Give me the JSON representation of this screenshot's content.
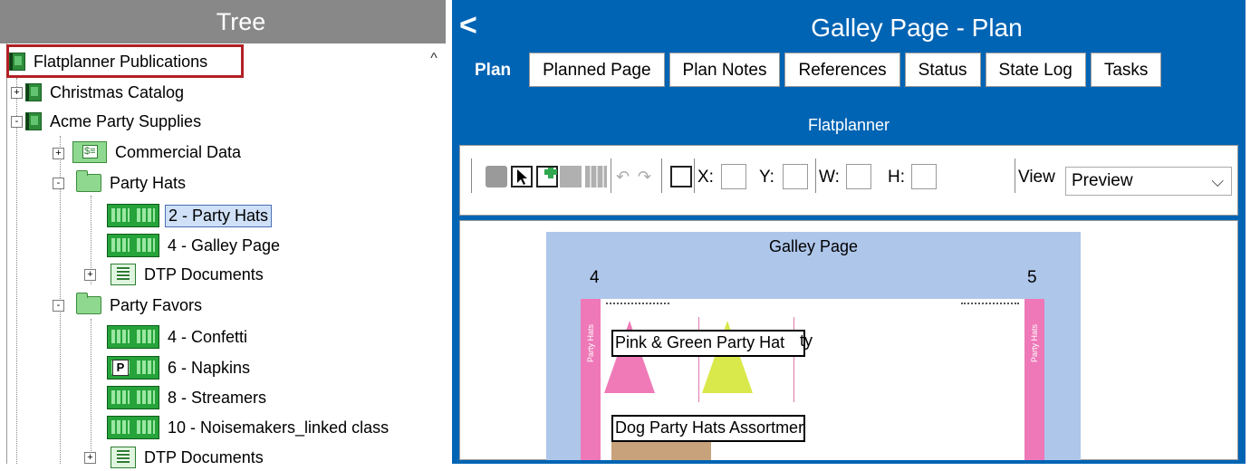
{
  "tree": {
    "title": "Tree",
    "scroll_up_glyph": "^",
    "items": [
      {
        "label": "Flatplanner Publications",
        "icon": "publications-icon",
        "expander": ""
      },
      {
        "label": "Christmas Catalog",
        "icon": "publication-icon",
        "expander": "+"
      },
      {
        "label": "Acme Party Supplies",
        "icon": "publication-icon",
        "expander": "-"
      },
      {
        "label": "Commercial Data",
        "icon": "commercial-data-icon",
        "expander": "+"
      },
      {
        "label": "Party Hats",
        "icon": "folder-icon",
        "expander": "-"
      },
      {
        "label": "2 - Party Hats",
        "icon": "page-spread-icon",
        "expander": "",
        "selected": true
      },
      {
        "label": "4 - Galley Page",
        "icon": "page-spread-icon",
        "expander": ""
      },
      {
        "label": "DTP Documents",
        "icon": "dtp-documents-icon",
        "expander": "+"
      },
      {
        "label": "Party Favors",
        "icon": "folder-icon",
        "expander": "-"
      },
      {
        "label": "4 - Confetti",
        "icon": "page-spread-icon",
        "expander": ""
      },
      {
        "label": "6 - Napkins",
        "icon": "page-spread-p-icon",
        "expander": ""
      },
      {
        "label": "8 - Streamers",
        "icon": "page-spread-icon",
        "expander": ""
      },
      {
        "label": "10 - Noisemakers_linked class",
        "icon": "page-spread-icon",
        "expander": ""
      },
      {
        "label": "DTP Documents",
        "icon": "dtp-documents-icon",
        "expander": "+"
      }
    ]
  },
  "right": {
    "title": "Galley Page - Plan",
    "back_glyph": "<",
    "tabs": [
      "Plan",
      "Planned Page",
      "Plan Notes",
      "References",
      "Status",
      "State Log",
      "Tasks"
    ],
    "section_title": "Flatplanner",
    "toolbar": {
      "x_label": "X:",
      "y_label": "Y:",
      "w_label": "W:",
      "h_label": "H:",
      "view_label": "View",
      "view_value": "Preview",
      "view_chevron": "⌵"
    },
    "galley": {
      "title": "Galley Page",
      "left_page": "4",
      "right_page": "5",
      "strip_left": "Party Hats",
      "strip_right": "Party Hats",
      "product_1": "Pink & Green Party Hat",
      "product_1_overflow": "ty",
      "product_2": "Dog Party Hats Assortmer"
    }
  },
  "colors": {
    "tree_header_bg": "#888888",
    "accent_blue": "#0064b4",
    "highlight_red": "#b22025",
    "selection_bg": "#cfe0f7",
    "galley_bg": "#aec6ea",
    "strip_pink": "#ee78b8"
  }
}
